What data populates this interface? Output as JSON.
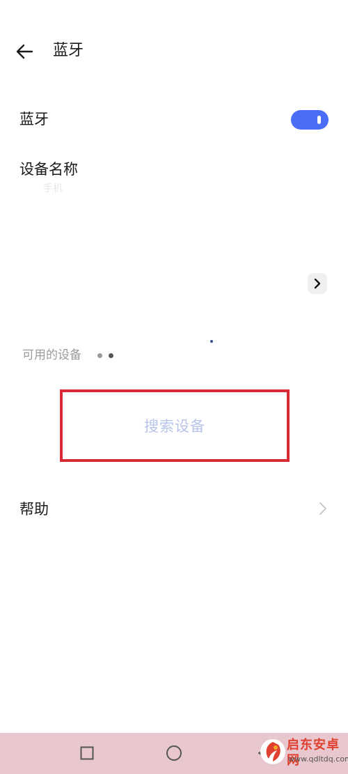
{
  "header": {
    "back_icon": "arrow-left-icon",
    "title": "蓝牙"
  },
  "bluetooth": {
    "label": "蓝牙",
    "enabled": true,
    "toggle_color": "#4a6cf7"
  },
  "device_name": {
    "label": "设备名称",
    "value": "手机"
  },
  "paired": {
    "chevron_icon": "chevron-right-icon"
  },
  "available": {
    "label": "可用的设备",
    "loading_icon": "loading-dots-icon"
  },
  "search": {
    "label": "搜索设备",
    "highlight_color": "#d82a35"
  },
  "help": {
    "label": "帮助",
    "chevron_icon": "chevron-right-icon"
  },
  "navbar": {
    "background": "#e8c7cf",
    "recent_icon": "square-icon",
    "home_icon": "circle-icon",
    "back_icon": "triangle-back-icon"
  },
  "watermark": {
    "brand": "启东安卓网",
    "url": "www.qdltdq.com"
  }
}
